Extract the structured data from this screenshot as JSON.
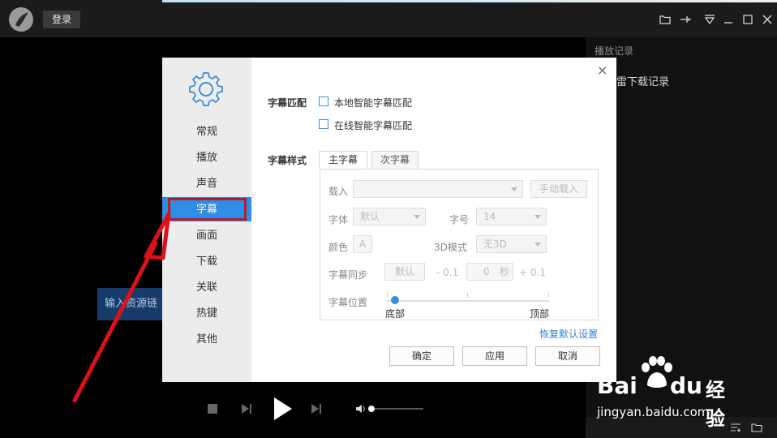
{
  "topbar": {
    "login_label": "登录"
  },
  "right_panel": {
    "title": "播放记录",
    "item": "雷下载记录"
  },
  "overlay": {
    "input_button": "输入资源链"
  },
  "dialog": {
    "nav": [
      "常规",
      "播放",
      "声音",
      "字幕",
      "画面",
      "下载",
      "关联",
      "热键",
      "其他"
    ],
    "active_nav": "字幕",
    "close_glyph": "×",
    "match_label": "字幕匹配",
    "option_local": "本地智能字幕匹配",
    "option_online": "在线智能字幕匹配",
    "style_label": "字幕样式",
    "tabs": [
      "主字幕",
      "次字幕"
    ],
    "load_label": "载入",
    "manual_load": "手动载入",
    "font_label": "字体",
    "font_value": "默认",
    "size_label": "字号",
    "size_value": "14",
    "color_label": "颜色",
    "color_value": "A",
    "mode3d_label": "3D模式",
    "mode3d_value": "无3D",
    "sync_label": "字幕同步",
    "sync_default": "默认",
    "sync_minus": "- 0.1",
    "sync_value": "0",
    "sync_unit": "秒",
    "sync_plus": "+ 0.1",
    "position_label": "字幕位置",
    "position_bottom": "底部",
    "position_top": "顶部",
    "position_level": 0.05,
    "restore": "恢复默认设置",
    "ok": "确定",
    "apply": "应用",
    "cancel": "取消"
  },
  "watermark": {
    "brand": "Bai",
    "brand2": "du",
    "cn": "经验",
    "url": "jingyan.baidu.com"
  },
  "colors": {
    "accent": "#2e8de4",
    "highlight_box": "#c8161d",
    "arrow": "#e0101a"
  }
}
